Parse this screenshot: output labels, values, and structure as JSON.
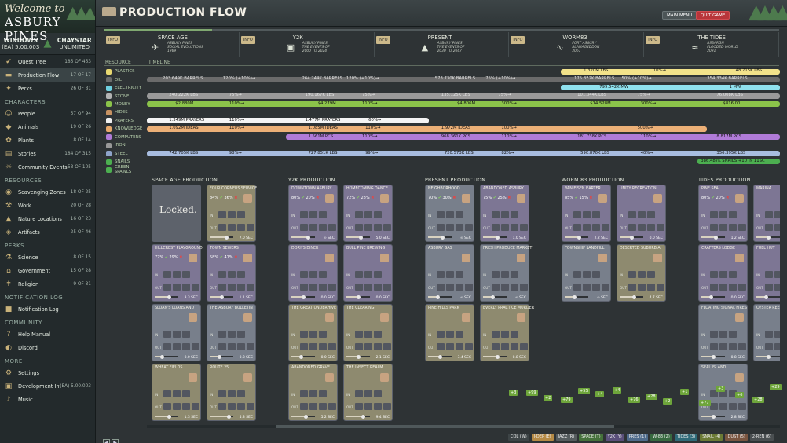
{
  "logo": {
    "line1": "Welcome to",
    "line2": "ASBURY PINES"
  },
  "status": {
    "windows_label": "WINDOWS",
    "windows_value": "(EA) 5.00.003",
    "chaystar_label": "CHAYSTAR",
    "chaystar_value": "UNLIMITED"
  },
  "sidebar": [
    {
      "type": "item",
      "name": "quest-tree",
      "label": "Quest Tree",
      "count": "185 OF 453",
      "icon": "quest-tree-icon"
    },
    {
      "type": "item",
      "name": "production-flow",
      "label": "Production Flow",
      "count": "17 OF 17",
      "icon": "production-flow-icon",
      "active": true
    },
    {
      "type": "item",
      "name": "perks",
      "label": "Perks",
      "count": "26 OF 81",
      "icon": "perks-icon"
    },
    {
      "type": "sec",
      "label": "CHARACTERS"
    },
    {
      "type": "item",
      "name": "people",
      "label": "People",
      "count": "57 OF 94",
      "icon": "people-icon"
    },
    {
      "type": "item",
      "name": "animals",
      "label": "Animals",
      "count": "19 OF 26",
      "icon": "animals-icon"
    },
    {
      "type": "item",
      "name": "plants",
      "label": "Plants",
      "count": "8 OF 14",
      "icon": "plants-icon"
    },
    {
      "type": "item",
      "name": "stories",
      "label": "Stories",
      "count": "184 OF 315",
      "icon": "stories-icon"
    },
    {
      "type": "item",
      "name": "community-events",
      "label": "Community Events",
      "count": "58 OF 105",
      "icon": "community-events-icon"
    },
    {
      "type": "sec",
      "label": "RESOURCES"
    },
    {
      "type": "item",
      "name": "scavenging-zones",
      "label": "Scavenging Zones",
      "count": "18 OF 25",
      "icon": "scavenging-icon"
    },
    {
      "type": "item",
      "name": "work",
      "label": "Work",
      "count": "20 OF 28",
      "icon": "work-icon"
    },
    {
      "type": "item",
      "name": "nature-locations",
      "label": "Nature Locations",
      "count": "16 OF 23",
      "icon": "nature-icon"
    },
    {
      "type": "item",
      "name": "artifacts",
      "label": "Artifacts",
      "count": "25 OF 46",
      "icon": "artifacts-icon"
    },
    {
      "type": "sec",
      "label": "PERKS"
    },
    {
      "type": "item",
      "name": "science",
      "label": "Science",
      "count": "8 OF 15",
      "icon": "science-icon"
    },
    {
      "type": "item",
      "name": "government",
      "label": "Government",
      "count": "15 OF 28",
      "icon": "government-icon"
    },
    {
      "type": "item",
      "name": "religion",
      "label": "Religion",
      "count": "9 OF 31",
      "icon": "religion-icon"
    },
    {
      "type": "sec",
      "label": "NOTIFICATION LOG"
    },
    {
      "type": "item",
      "name": "notification-log",
      "label": "Notification Log",
      "count": "",
      "icon": "notification-icon"
    },
    {
      "type": "sec",
      "label": "COMMUNITY"
    },
    {
      "type": "item",
      "name": "help-manual",
      "label": "Help Manual",
      "count": "",
      "icon": "help-icon"
    },
    {
      "type": "item",
      "name": "discord",
      "label": "Discord",
      "count": "",
      "icon": "discord-icon"
    },
    {
      "type": "sec",
      "label": "MORE"
    },
    {
      "type": "item",
      "name": "settings",
      "label": "Settings",
      "count": "",
      "icon": "settings-icon"
    },
    {
      "type": "item",
      "name": "development-info",
      "label": "Development Info",
      "count": "(EA) 5.00.003",
      "icon": "development-icon"
    },
    {
      "type": "item",
      "name": "music",
      "label": "Music",
      "count": "",
      "icon": "music-icon"
    }
  ],
  "header": {
    "title": "PRODUCTION FLOW",
    "main_menu": "MAIN MENU",
    "quit_game": "QUIT GAME"
  },
  "progress": 0.16,
  "eras": [
    {
      "name": "SPACE AGE",
      "info": "INFO",
      "sub": [
        "ASBURY PINES",
        "SOCIAL EVOLUTIONS",
        "1969"
      ],
      "icon": "rocket-icon"
    },
    {
      "name": "Y2K",
      "info": "INFO",
      "sub": [
        "ASBURY PINES",
        "THE EVENTS OF",
        "2000 TO 2024"
      ],
      "icon": "floppy-icon"
    },
    {
      "name": "PRESENT",
      "info": "INFO",
      "sub": [
        "ASBURY PINES",
        "THE EVENTS OF",
        "2030 TO 2047"
      ],
      "icon": "pine-icon"
    },
    {
      "name": "WORM83",
      "info": "INFO",
      "sub": [
        "FORT ASBURY",
        "ALAMAGEDDON",
        "2051"
      ],
      "icon": "worm-icon"
    },
    {
      "name": "THE TIDES",
      "info": "INFO",
      "sub": [
        "ASBARGH",
        "FLOODED WORLD",
        "2091"
      ],
      "icon": "wave-icon"
    }
  ],
  "timeline": {
    "resource_label": "RESOURCE",
    "timeline_label": "TIMELINE"
  },
  "resources": [
    {
      "name": "PLASTICS",
      "color": "#e8d870"
    },
    {
      "name": "OIL",
      "color": "#6b6b6b"
    },
    {
      "name": "ELECTRICITY",
      "color": "#6fd0e0"
    },
    {
      "name": "STONE",
      "color": "#b3b3b3"
    },
    {
      "name": "MONEY",
      "color": "#8bc34a"
    },
    {
      "name": "HIDES",
      "color": "#c79262"
    },
    {
      "name": "PRAYERS",
      "color": "#f0f0f0"
    },
    {
      "name": "KNOWLEDGE",
      "color": "#e8a86a"
    },
    {
      "name": "COMPUTERS",
      "color": "#b07bd8"
    },
    {
      "name": "IRON",
      "color": "#999999"
    },
    {
      "name": "STEEL",
      "color": "#8ea3c9"
    },
    {
      "name": "SNAILS",
      "color": "#4caf50"
    },
    {
      "name": "GREEN SPAWLS",
      "color": "#4caf50"
    }
  ],
  "bars": [
    {
      "row": 0,
      "start": 0.654,
      "end": 1.0,
      "color": "#f2e28a",
      "dark": false,
      "texts": [
        {
          "x": 0.69,
          "t": "1.320M LBS"
        },
        {
          "x": 0.8,
          "t": "10%→"
        },
        {
          "x": 0.93,
          "t": "48.715K LBS"
        }
      ]
    },
    {
      "row": 1,
      "start": 0.0,
      "end": 1.0,
      "color": "#6b6b6b",
      "dark": true,
      "texts": [
        {
          "x": 0.025,
          "t": "203.649K BARRELS"
        },
        {
          "x": 0.12,
          "t": "120% (+10%)→"
        },
        {
          "x": 0.245,
          "t": "264.744K BARRELS"
        },
        {
          "x": 0.315,
          "t": "120% (+10%)→"
        },
        {
          "x": 0.455,
          "t": "573.730K BARRELS"
        },
        {
          "x": 0.535,
          "t": "75% (+10%)→"
        },
        {
          "x": 0.675,
          "t": "175.352K BARRELS"
        },
        {
          "x": 0.75,
          "t": "50% (+10%)→"
        },
        {
          "x": 0.885,
          "t": "354.334K BARRELS"
        }
      ]
    },
    {
      "row": 2,
      "start": 0.654,
      "end": 1.0,
      "color": "#8fe1ee",
      "dark": false,
      "texts": [
        {
          "x": 0.715,
          "t": "799.542K MW"
        },
        {
          "x": 0.92,
          "t": "1 MW"
        }
      ]
    },
    {
      "row": 3,
      "start": 0.0,
      "end": 1.0,
      "color": "#9a9a9a",
      "dark": true,
      "texts": [
        {
          "x": 0.035,
          "t": "240.222K LBS"
        },
        {
          "x": 0.13,
          "t": "75%→"
        },
        {
          "x": 0.25,
          "t": "190.167K LBS"
        },
        {
          "x": 0.34,
          "t": "75%→"
        },
        {
          "x": 0.465,
          "t": "135.125K LBS"
        },
        {
          "x": 0.555,
          "t": "75%→"
        },
        {
          "x": 0.68,
          "t": "101.344K LBS"
        },
        {
          "x": 0.775,
          "t": "75%→"
        },
        {
          "x": 0.9,
          "t": "76.008K LBS"
        }
      ]
    },
    {
      "row": 4,
      "start": 0.0,
      "end": 1.0,
      "color": "#8bc34a",
      "dark": false,
      "texts": [
        {
          "x": 0.045,
          "t": "$2.880M"
        },
        {
          "x": 0.13,
          "t": "110%→"
        },
        {
          "x": 0.27,
          "t": "$4.279M"
        },
        {
          "x": 0.34,
          "t": "110%→"
        },
        {
          "x": 0.49,
          "t": "$4.806M"
        },
        {
          "x": 0.56,
          "t": "300%→"
        },
        {
          "x": 0.7,
          "t": "$14.528M"
        },
        {
          "x": 0.78,
          "t": "300%→"
        },
        {
          "x": 0.91,
          "t": "$816.00"
        }
      ]
    },
    {
      "row": 5,
      "start": 0.0,
      "end": 0.0,
      "color": "#c79262",
      "dark": false,
      "texts": []
    },
    {
      "row": 6,
      "start": 0.0,
      "end": 0.445,
      "color": "#f4f4f4",
      "dark": false,
      "texts": [
        {
          "x": 0.035,
          "t": "1.349M PRAYERS"
        },
        {
          "x": 0.13,
          "t": "110%→"
        },
        {
          "x": 0.25,
          "t": "1.477M PRAYERS"
        },
        {
          "x": 0.35,
          "t": "60%→"
        }
      ]
    },
    {
      "row": 7,
      "start": 0.0,
      "end": 0.885,
      "color": "#ecb077",
      "dark": false,
      "texts": [
        {
          "x": 0.035,
          "t": "1.092M IDEAS"
        },
        {
          "x": 0.13,
          "t": "110%→"
        },
        {
          "x": 0.255,
          "t": "1.085M IDEAS"
        },
        {
          "x": 0.345,
          "t": "110%→"
        },
        {
          "x": 0.465,
          "t": "1.972M IDEAS"
        },
        {
          "x": 0.56,
          "t": "100%→"
        },
        {
          "x": 0.775,
          "t": "500%→"
        }
      ]
    },
    {
      "row": 8,
      "start": 0.22,
      "end": 1.0,
      "color": "#b07bd8",
      "dark": false,
      "texts": [
        {
          "x": 0.255,
          "t": "1.561M PCS"
        },
        {
          "x": 0.34,
          "t": "110%→"
        },
        {
          "x": 0.465,
          "t": "968.361K PCS"
        },
        {
          "x": 0.56,
          "t": "110%→"
        },
        {
          "x": 0.68,
          "t": "181.738K PCS"
        },
        {
          "x": 0.78,
          "t": "110%→"
        },
        {
          "x": 0.9,
          "t": "8.817M PCS"
        }
      ]
    },
    {
      "row": 9,
      "start": 0.0,
      "end": 0.0,
      "color": "#999",
      "dark": false,
      "texts": []
    },
    {
      "row": 10,
      "start": 0.0,
      "end": 1.0,
      "color": "#a8bde0",
      "dark": false,
      "texts": [
        {
          "x": 0.035,
          "t": "742.705K LBS"
        },
        {
          "x": 0.13,
          "t": "98%→"
        },
        {
          "x": 0.255,
          "t": "727.851K LBS"
        },
        {
          "x": 0.345,
          "t": "99%→"
        },
        {
          "x": 0.47,
          "t": "720.573K LBS"
        },
        {
          "x": 0.56,
          "t": "82%→"
        },
        {
          "x": 0.685,
          "t": "590.870K LBS"
        },
        {
          "x": 0.78,
          "t": "40%→"
        },
        {
          "x": 0.9,
          "t": "356.395K LBS"
        }
      ]
    },
    {
      "row": 11,
      "start": 0.87,
      "end": 1.0,
      "color": "#4caf50",
      "dark": false,
      "texts": [
        {
          "x": 0.875,
          "t": "386.487K SNAILS +10 IN 11SC"
        }
      ]
    }
  ],
  "columns": [
    {
      "title": "SPACE AGE PRODUCTION",
      "cards": [
        {
          "name": "",
          "locked": true,
          "lock_text": "Locked."
        },
        {
          "name": "FOUR CORNERS SERVICE",
          "pct_ok": "84%",
          "pct_no": "36%",
          "sec": "7.0 SEC",
          "tone": "g",
          "level": 0.7
        },
        {
          "name": "HILLCREST PLAYGROUND",
          "pct_ok": "77%",
          "pct_no": "29%",
          "sec": "3.3 SEC",
          "tone": "v",
          "level": 0.6
        },
        {
          "name": "TOWN SEWERS",
          "pct_ok": "58%",
          "pct_no": "41%",
          "sec": "1.1 SEC",
          "tone": "v",
          "level": 0.5
        },
        {
          "name": "SLOAN'S LOANS AND",
          "pct_ok": "",
          "pct_no": "",
          "sec": "0.0 SEC",
          "tone": "",
          "level": 0.3
        },
        {
          "name": "THE ASBURY BULLETIN",
          "pct_ok": "",
          "pct_no": "",
          "sec": "0.8 SEC",
          "tone": "",
          "level": 0.4
        },
        {
          "name": "WHEAT FIELDS",
          "pct_ok": "",
          "pct_no": "",
          "sec": "1.3 SEC",
          "tone": "g",
          "level": 0.6
        },
        {
          "name": "ROUTE 25",
          "pct_ok": "",
          "pct_no": "",
          "sec": "5.3 SEC",
          "tone": "g",
          "level": 0.8
        }
      ]
    },
    {
      "title": "Y2K PRODUCTION",
      "cards": [
        {
          "name": "DOWNTOWN ASBURY",
          "pct_ok": "80%",
          "pct_no": "20%",
          "sec": "∞ SEC",
          "tone": "v",
          "level": 0.7
        },
        {
          "name": "HOMECOMING DANCE",
          "pct_ok": "72%",
          "pct_no": "28%",
          "sec": "5.0 SEC",
          "tone": "v",
          "level": 0.6
        },
        {
          "name": "DORY'S DINER",
          "pct_ok": "",
          "pct_no": "",
          "sec": "0.0 SEC",
          "tone": "v",
          "level": 0.5
        },
        {
          "name": "BULL PINE BREWING",
          "pct_ok": "",
          "pct_no": "",
          "sec": "0.0 SEC",
          "tone": "v",
          "level": 0.5
        },
        {
          "name": "THE GREAT UNDERHIVE",
          "pct_ok": "",
          "pct_no": "",
          "sec": "0.0 SEC",
          "tone": "g",
          "level": 0.4
        },
        {
          "name": "THE CLEARING",
          "pct_ok": "",
          "pct_no": "",
          "sec": "2.1 SEC",
          "tone": "g",
          "level": 0.5
        },
        {
          "name": "ABANDONED GRAVE",
          "pct_ok": "",
          "pct_no": "",
          "sec": "5.2 SEC",
          "tone": "g",
          "level": 0.6
        },
        {
          "name": "THE INSECT REALM",
          "pct_ok": "",
          "pct_no": "",
          "sec": "9.4 SEC",
          "tone": "g",
          "level": 0.7
        }
      ]
    },
    {
      "title": "PRESENT PRODUCTION",
      "cards": [
        {
          "name": "NEIGHBORHOOD",
          "pct_ok": "70%",
          "pct_no": "30%",
          "sec": "∞ SEC",
          "tone": "",
          "level": 0.6
        },
        {
          "name": "ABANDONED ASBURY",
          "pct_ok": "75%",
          "pct_no": "25%",
          "sec": "1.0 SEC",
          "tone": "v",
          "level": 0.6
        },
        {
          "name": "ASBURY GAS",
          "pct_ok": "",
          "pct_no": "",
          "sec": "∞ SEC",
          "tone": "",
          "level": 0.4
        },
        {
          "name": "FRESH PRODUCE MARKET",
          "pct_ok": "",
          "pct_no": "",
          "sec": "∞ SEC",
          "tone": "",
          "level": 0.4
        },
        {
          "name": "PINE HILLS PARK",
          "pct_ok": "",
          "pct_no": "",
          "sec": "3.4 SEC",
          "tone": "g",
          "level": 0.5
        },
        {
          "name": "EVERLY PRACTICE MURDER",
          "pct_ok": "",
          "pct_no": "",
          "sec": "0.8 SEC",
          "tone": "g",
          "level": 0.6
        }
      ]
    },
    {
      "title": "WORM 83 PRODUCTION",
      "cards": [
        {
          "name": "VAN EISEN BARTER",
          "pct_ok": "85%",
          "pct_no": "15%",
          "sec": "2.2 SEC",
          "tone": "v",
          "level": 0.6
        },
        {
          "name": "UNITY RECREATION",
          "pct_ok": "",
          "pct_no": "",
          "sec": "0.0 SEC",
          "tone": "v",
          "level": 0.5
        },
        {
          "name": "TOWNSHIP LANDFILL",
          "pct_ok": "",
          "pct_no": "",
          "sec": "∞ SEC",
          "tone": "",
          "level": 0.4
        },
        {
          "name": "DESERTED SUBURBIA",
          "pct_ok": "",
          "pct_no": "",
          "sec": "4.7 SEC",
          "tone": "g",
          "level": 0.6
        }
      ]
    },
    {
      "title": "TIDES PRODUCTION",
      "cards": [
        {
          "name": "PINE SEA",
          "pct_ok": "80%",
          "pct_no": "20%",
          "sec": "1.2 SEC",
          "tone": "v",
          "level": 0.6
        },
        {
          "name": "MARINA",
          "pct_ok": "",
          "pct_no": "",
          "sec": "",
          "tone": "v",
          "level": 0.5
        },
        {
          "name": "CRAFTERS LODGE",
          "pct_ok": "",
          "pct_no": "",
          "sec": "0.0 SEC",
          "tone": "v",
          "level": 0.4
        },
        {
          "name": "FUEL HUT",
          "pct_ok": "",
          "pct_no": "",
          "sec": "",
          "tone": "v",
          "level": 0.4
        },
        {
          "name": "FLOATING SIGNAL FIRES",
          "pct_ok": "",
          "pct_no": "",
          "sec": "0.8 SEC",
          "tone": "",
          "level": 0.5
        },
        {
          "name": "OYSTER REEF",
          "pct_ok": "",
          "pct_no": "",
          "sec": "",
          "tone": "",
          "level": 0.5
        },
        {
          "name": "SEAL ISLAND",
          "pct_ok": "",
          "pct_no": "",
          "sec": "2.8 SEC",
          "tone": "",
          "level": 0.5
        }
      ]
    }
  ],
  "drops": [
    "+3",
    "+99",
    "+2",
    "+79",
    "+55",
    "+4",
    "+4",
    "+76",
    "+28",
    "+2",
    "+1",
    "+77",
    "+3",
    "+6",
    "+28",
    "+29"
  ],
  "filters": [
    {
      "label": "COL (W)",
      "color": "#3d4446"
    },
    {
      "label": "I-DEP (E)",
      "color": "#b58a45"
    },
    {
      "label": "JAZZ (R)",
      "color": "#555c5e"
    },
    {
      "label": "SPACE (T)",
      "color": "#45713b"
    },
    {
      "label": "Y2K (Y)",
      "color": "#5a4f7a"
    },
    {
      "label": "PRES (1)",
      "color": "#4f6b8b"
    },
    {
      "label": "W-83 (2)",
      "color": "#37693f"
    },
    {
      "label": "TIDES (3)",
      "color": "#2f6a78"
    },
    {
      "label": "SNAIL (4)",
      "color": "#6b7a35"
    },
    {
      "label": "DUST (5)",
      "color": "#7a5540"
    },
    {
      "label": "2-REN (6)",
      "color": "#4a4f51"
    }
  ]
}
